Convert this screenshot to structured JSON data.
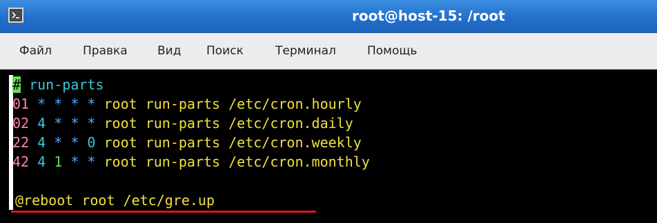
{
  "window": {
    "title": "root@host-15: /root",
    "icon": "terminal-icon"
  },
  "menu": [
    {
      "label": "Файл"
    },
    {
      "label": "Правка"
    },
    {
      "label": "Вид"
    },
    {
      "label": "Поиск"
    },
    {
      "label": "Терминал"
    },
    {
      "label": "Помощь"
    }
  ],
  "terminal": {
    "lines": [
      {
        "hash": "#",
        "text": " run-parts"
      },
      {
        "minute": "01",
        "hour": "*",
        "dom": "*",
        "month": "*",
        "dow": "*",
        "cmd": "root run-parts /etc/cron.hourly"
      },
      {
        "minute": "02",
        "hour": "4",
        "dom": "*",
        "month": "*",
        "dow": "*",
        "cmd": "root run-parts /etc/cron.daily"
      },
      {
        "minute": "22",
        "hour": "4",
        "dom": "*",
        "month": "*",
        "dow": "0",
        "cmd": "root run-parts /etc/cron.weekly"
      },
      {
        "minute": "42",
        "hour": "4",
        "dom": "1",
        "month": "*",
        "dow": "*",
        "cmd": "root run-parts /etc/cron.monthly"
      },
      {
        "text": "@reboot root /etc/gre.up"
      }
    ]
  },
  "colors": {
    "titlebar": "#2470cc",
    "menubar": "#ececec",
    "terminal_bg": "#000000",
    "highlight_underline": "#e0151a"
  }
}
